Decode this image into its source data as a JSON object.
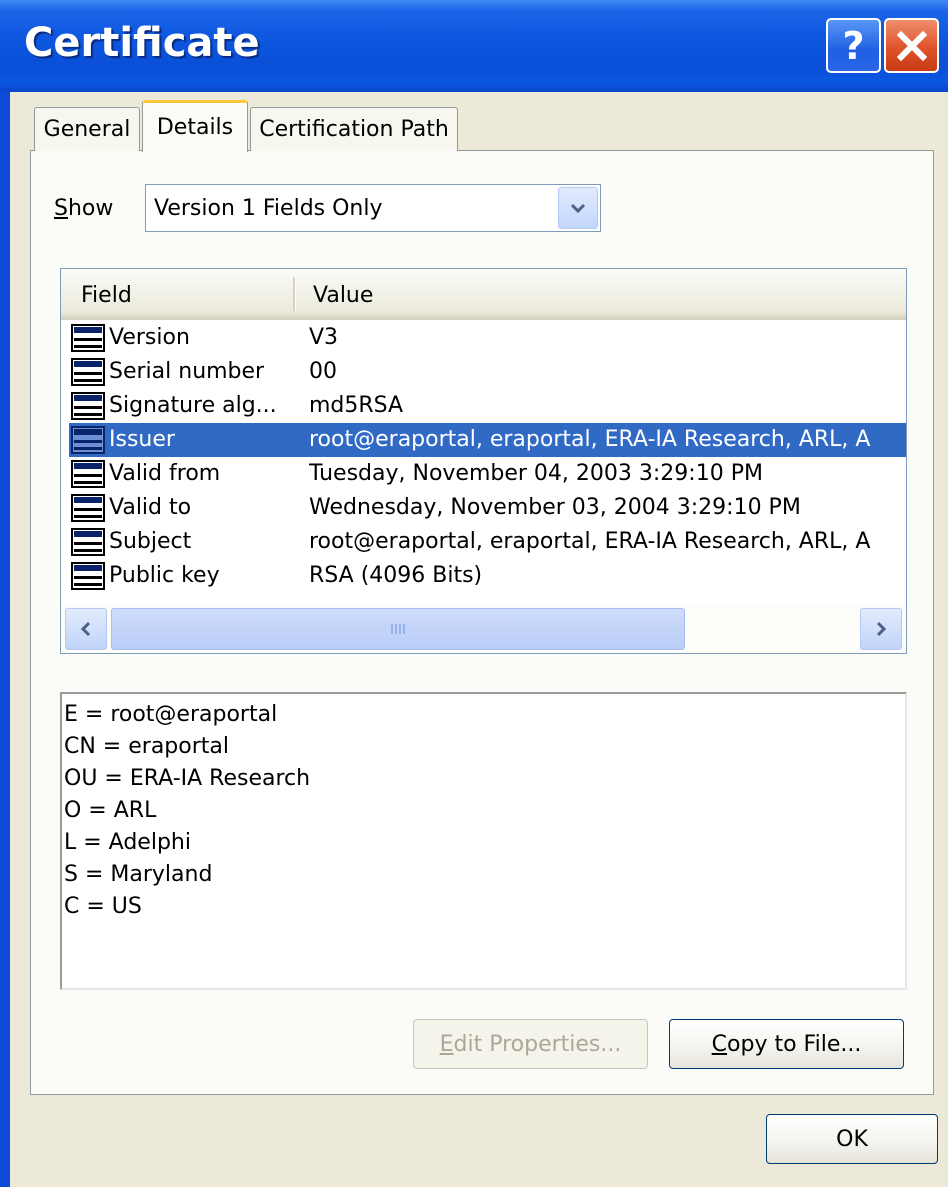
{
  "window": {
    "title": "Certificate",
    "help_label": "?",
    "close_label": "✕"
  },
  "tabs": [
    {
      "label": "General",
      "active": false
    },
    {
      "label": "Details",
      "active": true
    },
    {
      "label": "Certification Path",
      "active": false
    }
  ],
  "show": {
    "label_accel": "S",
    "label_rest": "how",
    "selected": "Version 1 Fields Only"
  },
  "list": {
    "columns": [
      "Field",
      "Value"
    ],
    "rows": [
      {
        "field": "Version",
        "value": "V3",
        "selected": false
      },
      {
        "field": "Serial number",
        "value": "00",
        "selected": false
      },
      {
        "field": "Signature alg...",
        "value": "md5RSA",
        "selected": false
      },
      {
        "field": "Issuer",
        "value": "root@eraportal, eraportal, ERA-IA Research, ARL, A",
        "selected": true
      },
      {
        "field": "Valid from",
        "value": "Tuesday, November 04, 2003 3:29:10 PM",
        "selected": false
      },
      {
        "field": "Valid to",
        "value": "Wednesday, November 03, 2004 3:29:10 PM",
        "selected": false
      },
      {
        "field": "Subject",
        "value": "root@eraportal, eraportal, ERA-IA Research, ARL, A",
        "selected": false
      },
      {
        "field": "Public key",
        "value": "RSA (4096 Bits)",
        "selected": false
      }
    ]
  },
  "details": {
    "lines": [
      "E = root@eraportal",
      "CN = eraportal",
      "OU = ERA-IA Research",
      "O = ARL",
      "L = Adelphi",
      "S = Maryland",
      "C = US"
    ]
  },
  "buttons": {
    "edit_accel": "E",
    "edit_rest": "dit Properties...",
    "copy_accel": "C",
    "copy_rest": "opy to File...",
    "ok": "OK"
  },
  "colors": {
    "titlebar": "#0a4fd8",
    "selection": "#316ac5",
    "dialog_bg": "#ece9d8",
    "active_tab_accent": "#ffc83c"
  }
}
